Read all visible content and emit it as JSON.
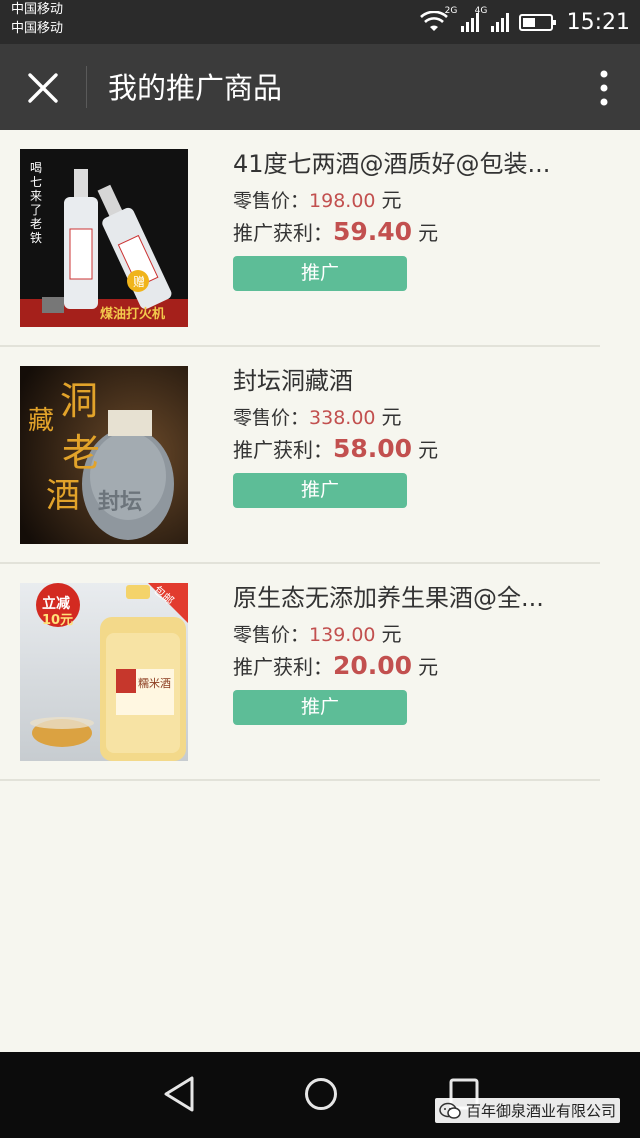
{
  "status_bar": {
    "carrier_line1": "中国移动",
    "carrier_line2": "中国移动",
    "net1": "2G",
    "net2": "4G",
    "time": "15:21"
  },
  "nav": {
    "title": "我的推广商品"
  },
  "labels": {
    "retail_price": "零售价：",
    "promo_profit": "推广获利：",
    "unit": "元",
    "promote_button": "推广"
  },
  "products": [
    {
      "title": "41度七两酒@酒质好@包装...",
      "retail_price": "198.00",
      "profit": "59.40",
      "image_text": {
        "side": "喝七来了老铁",
        "gift": "赠",
        "gift_caption": "煤油打火机"
      }
    },
    {
      "title": "封坛洞藏酒",
      "retail_price": "338.00",
      "profit": "58.00",
      "image_text": {
        "big1": "洞",
        "big2": "藏",
        "big3": "老",
        "big4": "酒",
        "jar": "封坛"
      }
    },
    {
      "title": "原生态无添加养生果酒@全...",
      "retail_price": "139.00",
      "profit": "20.00",
      "image_text": {
        "badge_line1": "立减",
        "badge_line2": "10元",
        "corner": "包邮",
        "bottle_label": "糯米酒"
      }
    }
  ],
  "watermark": {
    "text": "百年御泉酒业有限公司"
  },
  "colors": {
    "status_bg": "#2b2b2b",
    "nav_bg": "#3b3b3b",
    "page_bg": "#f6f6ef",
    "price_red": "#c2504f",
    "button_green": "#5dbd97"
  }
}
